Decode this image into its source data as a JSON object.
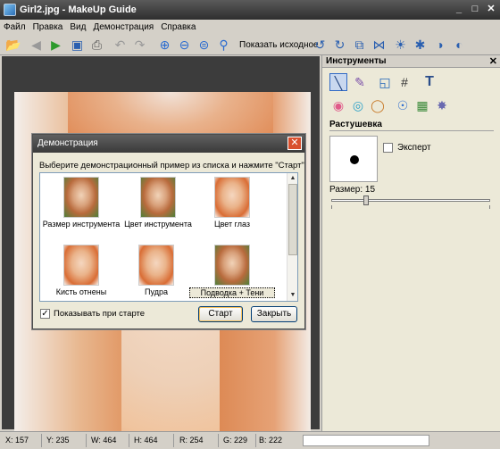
{
  "window": {
    "title": "Girl2.jpg - MakeUp Guide",
    "min": "_",
    "max": "□",
    "close": "✕"
  },
  "menu": [
    "Файл",
    "Правка",
    "Вид",
    "Демонстрация",
    "Справка"
  ],
  "toolbar": {
    "show_original": "Показать исходное"
  },
  "panel": {
    "title": "Инструменты",
    "close": "✕",
    "feather_heading": "Растушевка",
    "expert_label": "Эксперт",
    "expert_checked": false,
    "size_label": "Размер: 15",
    "size_value": 15
  },
  "status": {
    "x": "X: 157",
    "y": "Y: 235",
    "w": "W: 464",
    "h": "H: 464",
    "r": "R: 254",
    "g": "G: 229",
    "b": "B: 222"
  },
  "dialog": {
    "title": "Демонстрация",
    "close": "✕",
    "prompt": "Выберите демонстрационный пример из списка и нажмите \"Старт\"",
    "samples": [
      {
        "label": "Размер инструмента"
      },
      {
        "label": "Цвет инструмента"
      },
      {
        "label": "Цвет глаз"
      },
      {
        "label": "Кисть отнены"
      },
      {
        "label": "Пудра"
      },
      {
        "label": "Подводка + Тени"
      }
    ],
    "show_at_start_label": "Показывать при старте",
    "show_at_start_checked": true,
    "start_button": "Старт",
    "close_button": "Закрыть"
  }
}
